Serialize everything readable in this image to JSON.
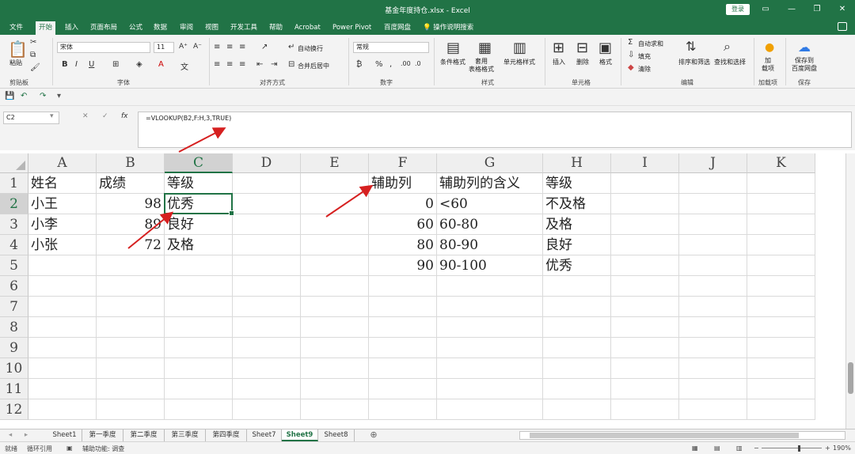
{
  "window": {
    "title": "基金年度持仓.xlsx - Excel",
    "login_label": "登录",
    "ribbon_display_icon": "ribbon-display-options-icon",
    "minimize": "—",
    "maximize": "❐",
    "close": "✕"
  },
  "tabs": [
    "文件",
    "开始",
    "插入",
    "页面布局",
    "公式",
    "数据",
    "审阅",
    "视图",
    "开发工具",
    "帮助",
    "Acrobat",
    "Power Pivot",
    "百度网盘"
  ],
  "active_tab": "开始",
  "tell_me": "操作说明搜索",
  "ribbon": {
    "clipboard": {
      "paste": "粘贴",
      "label": "剪贴板"
    },
    "font": {
      "name": "宋体",
      "size": "11",
      "label": "字体"
    },
    "alignment": {
      "wrap": "自动换行",
      "merge": "合并后居中",
      "label": "对齐方式"
    },
    "number": {
      "format": "常规",
      "label": "数字"
    },
    "styles": {
      "conditional": "条件格式",
      "table": "套用\n表格格式",
      "cell_styles": "单元格样式",
      "label": "样式"
    },
    "cells": {
      "insert": "插入",
      "delete": "删除",
      "format": "格式",
      "label": "单元格"
    },
    "editing": {
      "autosum": "自动求和",
      "fill": "填充",
      "clear": "清除",
      "sort": "排序和筛选",
      "find": "查找和选择",
      "label": "编辑"
    },
    "addins": {
      "add": "加\n载项",
      "label": "加载项"
    },
    "save": {
      "baidu": "保存到\n百度网盘",
      "label": "保存"
    }
  },
  "formula_bar": {
    "name_box": "C2",
    "cancel": "✕",
    "enter": "✓",
    "fx": "fx",
    "formula": "=VLOOKUP(B2,F:H,3,TRUE)"
  },
  "grid": {
    "columns": [
      "A",
      "B",
      "C",
      "D",
      "E",
      "F",
      "G",
      "H",
      "I",
      "J",
      "K"
    ],
    "selected_column": "C",
    "rows": [
      "1",
      "2",
      "3",
      "4",
      "5",
      "6",
      "7",
      "8",
      "9",
      "10",
      "11",
      "12"
    ],
    "selected_row": "2",
    "active_cell": "C2",
    "cells": {
      "A1": "姓名",
      "B1": "成绩",
      "C1": "等级",
      "A2": "小王",
      "B2": "98",
      "C2": "优秀",
      "A3": "小李",
      "B3": "89",
      "C3": "良好",
      "A4": "小张",
      "B4": "72",
      "C4": "及格",
      "F1": "辅助列",
      "G1": "辅助列的含义",
      "H1": "等级",
      "F2": "0",
      "G2": "<60",
      "H2": "不及格",
      "F3": "60",
      "G3": "60-80",
      "H3": "及格",
      "F4": "80",
      "G4": "80-90",
      "H4": "良好",
      "F5": "90",
      "G5": "90-100",
      "H5": "优秀"
    }
  },
  "sheets": [
    "Sheet1",
    "第一季度",
    "第二季度",
    "第三季度",
    "第四季度",
    "Sheet7",
    "Sheet9",
    "Sheet8"
  ],
  "active_sheet": "Sheet9",
  "status": {
    "ready": "就绪",
    "circular": "循环引用",
    "accessibility": "辅助功能: 调查",
    "zoom": "190%"
  },
  "colors": {
    "accent": "#217346",
    "arrow": "#d62020"
  }
}
